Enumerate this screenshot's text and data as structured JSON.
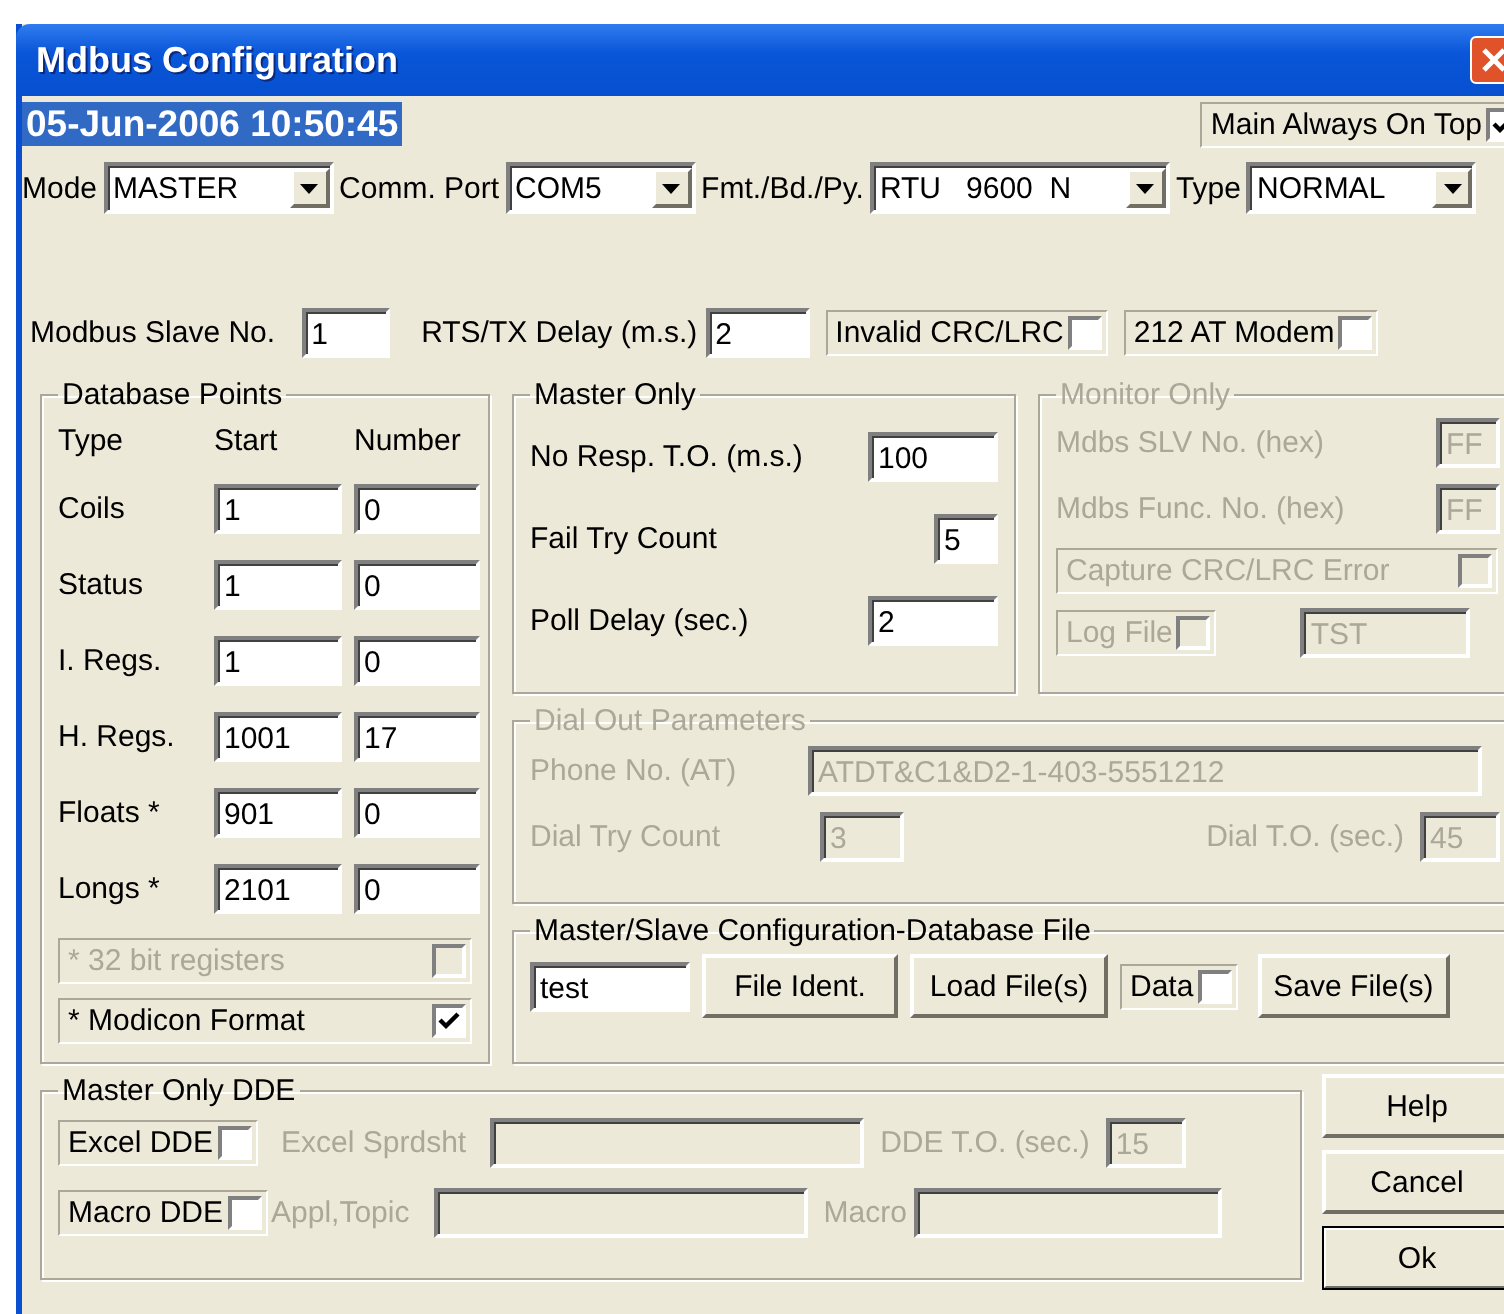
{
  "window": {
    "title": "Mdbus Configuration"
  },
  "timestamp": "05-Jun-2006 10:50:45",
  "always_on_top": {
    "label": "Main Always On Top",
    "checked": true
  },
  "selectors": [
    {
      "label": "Mode",
      "value": "MASTER"
    },
    {
      "label": "Comm. Port",
      "value": "COM5"
    },
    {
      "label": "Fmt./Bd./Py.",
      "value": "RTU   9600  N"
    },
    {
      "label": "Type",
      "value": "NORMAL"
    }
  ],
  "settings": [
    {
      "kind": "field",
      "label": "Modbus Slave No.",
      "value": "1"
    },
    {
      "kind": "field",
      "label": "RTS/TX Delay (m.s.)",
      "value": "2"
    },
    {
      "kind": "check",
      "label": "Invalid CRC/LRC",
      "checked": false
    },
    {
      "kind": "check",
      "label": "212 AT Modem",
      "checked": false
    }
  ],
  "database_points": {
    "title": "Database Points",
    "columns": [
      "Type",
      "Start",
      "Number"
    ],
    "rows": [
      {
        "type": "Coils",
        "start": "1",
        "number": "0"
      },
      {
        "type": "Status",
        "start": "1",
        "number": "0"
      },
      {
        "type": "I. Regs.",
        "start": "1",
        "number": "0"
      },
      {
        "type": "H. Regs.",
        "start": "1001",
        "number": "17"
      },
      {
        "type": "Floats *",
        "start": "901",
        "number": "0"
      },
      {
        "type": "Longs *",
        "start": "2101",
        "number": "0"
      }
    ],
    "options": [
      {
        "label": "* 32 bit registers",
        "checked": false,
        "disabled": true
      },
      {
        "label": "* Modicon Format",
        "checked": true,
        "disabled": false
      }
    ]
  },
  "master_only": {
    "title": "Master Only",
    "fields": [
      {
        "label": "No Resp. T.O. (m.s.)",
        "value": "100"
      },
      {
        "label": "Fail Try Count",
        "value": "5"
      },
      {
        "label": "Poll Delay (sec.)",
        "value": "2"
      }
    ]
  },
  "monitor_only": {
    "title": "Monitor Only",
    "disabled": true,
    "fields": [
      {
        "label": "Mdbs SLV No. (hex)",
        "value": "FF"
      },
      {
        "label": "Mdbs Func. No. (hex)",
        "value": "FF"
      }
    ],
    "capture": {
      "label": "Capture CRC/LRC Error",
      "checked": false
    },
    "log_file": {
      "label": "Log File",
      "checked": false,
      "value": "TST"
    }
  },
  "dial_out": {
    "title": "Dial Out Parameters",
    "disabled": true,
    "phone": {
      "label": "Phone No. (AT)",
      "value": "ATDT&C1&D2-1-403-5551212"
    },
    "try_count": {
      "label": "Dial Try Count",
      "value": "3"
    },
    "timeout": {
      "label": "Dial T.O. (sec.)",
      "value": "45"
    }
  },
  "file_panel": {
    "title": "Master/Slave Configuration-Database File",
    "file_name": "test",
    "buttons": [
      "File Ident.",
      "Load File(s)"
    ],
    "data": {
      "label": "Data",
      "checked": false
    },
    "save_button": "Save File(s)"
  },
  "dde": {
    "title": "Master Only DDE",
    "excel": {
      "label": "Excel DDE",
      "checked": false
    },
    "excel_sheet": {
      "label": "Excel Sprdsht",
      "disabled": true
    },
    "timeout": {
      "label": "DDE T.O. (sec.)",
      "value": "15",
      "disabled": true
    },
    "macro_dde": {
      "label": "Macro DDE",
      "checked": false
    },
    "topic": {
      "label": "Appl,Topic",
      "disabled": true
    },
    "macro": {
      "label": "Macro",
      "disabled": true
    }
  },
  "buttons": [
    {
      "label": "Help",
      "default": false
    },
    {
      "label": "Cancel",
      "default": false
    },
    {
      "label": "Ok",
      "default": true
    }
  ]
}
